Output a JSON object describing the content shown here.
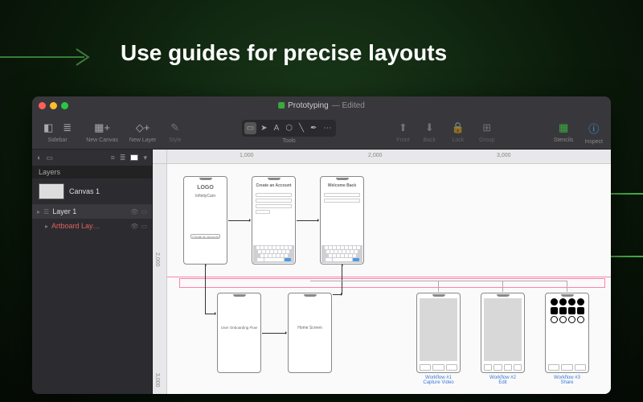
{
  "headline": "Use guides for precise layouts",
  "window": {
    "doc_title": "Prototyping",
    "doc_status": "— Edited"
  },
  "toolbar": {
    "sidebar": "Sidebar",
    "new_canvas": "New Canvas",
    "new_layer": "New Layer",
    "style": "Style",
    "tools": "Tools",
    "front": "Front",
    "back": "Back",
    "lock": "Lock",
    "group": "Group",
    "stencils": "Stencils",
    "inspect": "Inspect"
  },
  "sidebar": {
    "section": "Layers",
    "canvas": "Canvas 1",
    "layer1": "Layer 1",
    "artboard": "Artboard Lay…"
  },
  "ruler": {
    "h1": "1,000",
    "h2": "2,000",
    "h3": "3,000",
    "v1": "2,000",
    "v2": "3,000"
  },
  "mockups": {
    "logo": "LOGO",
    "infinitycam": "InfinityCam",
    "create_btn": "Create an Account",
    "create_title": "Create an Account",
    "welcome": "Welcome Back",
    "onboarding": "User Onboarding Flow",
    "home": "Home Screen",
    "w1_name": "Workflow #1",
    "w1_sub": "Capture Video",
    "w2_name": "Workflow #2",
    "w2_sub": "Edit",
    "w3_name": "Workflow #3",
    "w3_sub": "Share"
  }
}
